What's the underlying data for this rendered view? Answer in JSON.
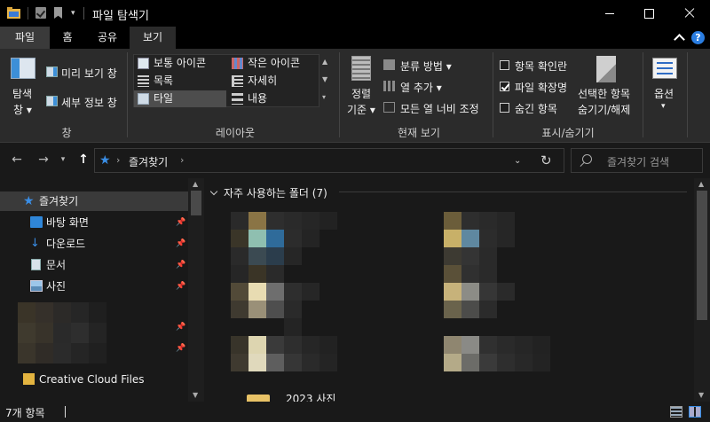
{
  "titlebar": {
    "title": "파일 탐색기",
    "dropdown_glyph": "▾"
  },
  "tabs": {
    "file": "파일",
    "home": "홈",
    "share": "공유",
    "view": "보기",
    "active": "보기"
  },
  "help_glyph": "?",
  "ribbon": {
    "pane": {
      "navigation_pane_line1": "탐색",
      "navigation_pane_line2": "창 ▾",
      "preview_pane": "미리 보기 창",
      "details_pane": "세부 정보 창",
      "group_label": "창"
    },
    "layout": {
      "items": [
        "보통 아이콘",
        "작은 아이콘",
        "목록",
        "자세히",
        "타일",
        "내용"
      ],
      "selected": "타일",
      "group_label": "레이아웃",
      "scroll_glyphs": [
        "▲",
        "▼",
        "▾"
      ]
    },
    "current_view": {
      "sort_line1": "정렬",
      "sort_line2": "기준 ▾",
      "group_by": "분류 방법 ▾",
      "add_columns": "열 추가 ▾",
      "size_all_columns": "모든 열 너비 조정",
      "group_label": "현재 보기"
    },
    "show_hide": {
      "item_checkboxes": {
        "label": "항목 확인란",
        "checked": false
      },
      "file_extensions": {
        "label": "파일 확장명",
        "checked": true
      },
      "hidden_items": {
        "label": "숨긴 항목",
        "checked": false
      },
      "hide_selected_line1": "선택한 항목",
      "hide_selected_line2": "숨기기/해제",
      "group_label": "표시/숨기기"
    },
    "options": {
      "label": "옵션",
      "dropdown_glyph": "▾"
    }
  },
  "address": {
    "back_glyph": "←",
    "forward_glyph": "→",
    "recent_glyph": "▾",
    "up_glyph": "↑",
    "star_glyph": "★",
    "separator_glyph": "›",
    "path": "즐겨찾기",
    "dropdown_glyph": "⌄",
    "refresh_glyph": "↻",
    "search_placeholder": "즐겨찾기 검색"
  },
  "nav_pane": {
    "quick_access": "즐겨찾기",
    "pinned": [
      {
        "label": "바탕 화면",
        "icon": "desktop-icon"
      },
      {
        "label": "다운로드",
        "icon": "download-icon"
      },
      {
        "label": "문서",
        "icon": "document-icon"
      },
      {
        "label": "사진",
        "icon": "pictures-icon"
      }
    ],
    "pin_glyph": "📌",
    "creative_cloud": "Creative Cloud Files",
    "scroll_glyphs": [
      "▲",
      "▼"
    ]
  },
  "content": {
    "group_title": "자주 사용하는 폴더 (7)",
    "partial_tile_label": "2023 사진",
    "scroll_glyphs": [
      "▲",
      "▼"
    ]
  },
  "status": {
    "item_count": "7개 항목"
  },
  "colors": {
    "accent": "#3a8ee6",
    "background": "#191919",
    "ribbon": "#2b2b2b",
    "titlebar": "#000000"
  }
}
